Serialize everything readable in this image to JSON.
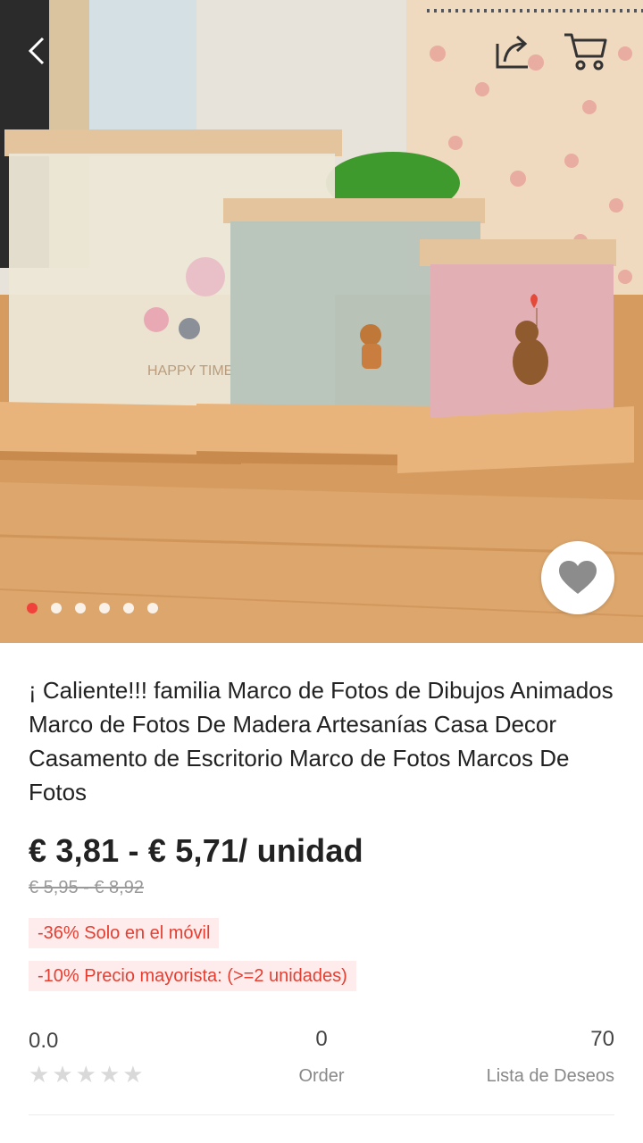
{
  "product": {
    "title": "¡ Caliente!!! familia Marco de Fotos de Dibujos Animados Marco de Fotos De Madera Artesanías Casa Decor Casamento de Escritorio Marco de Fotos Marcos De Fotos",
    "price": "€ 3,81 - € 5,71/ unidad",
    "original_price": "€ 5,95 - € 8,92",
    "promo_tags": [
      "-36% Solo en el móvil",
      "-10% Precio mayorista: (>=2 unidades)"
    ]
  },
  "gallery": {
    "image_count": 6,
    "active_index": 0,
    "accent_color": "#f0423a"
  },
  "stats": {
    "rating": "0.0",
    "stars_filled": 0,
    "stars_total": 5,
    "orders": "0",
    "orders_label": "Order",
    "wishlist": "70",
    "wishlist_label": "Lista de Deseos"
  },
  "icons": {
    "back": "chevron-left-icon",
    "share": "share-icon",
    "cart": "cart-icon",
    "wishlist": "heart-icon"
  }
}
